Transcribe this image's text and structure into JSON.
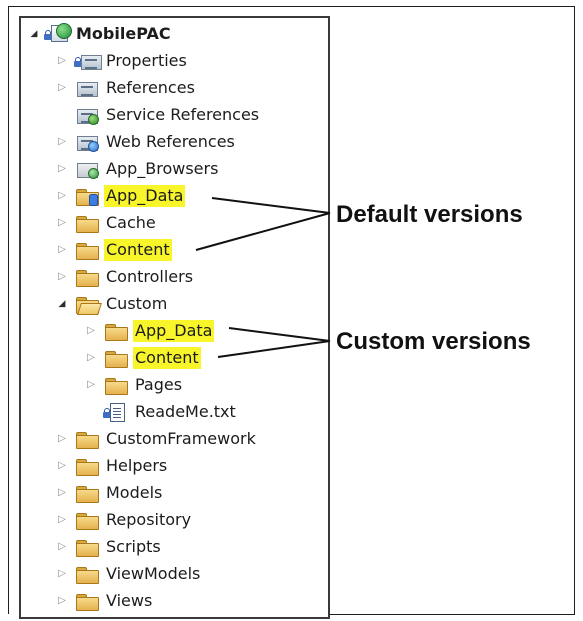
{
  "tree": {
    "root": {
      "label": "MobilePAC",
      "expanded": true,
      "icon": "csharp-project-icon"
    },
    "items": [
      {
        "label": "Properties",
        "icon": "properties-icon",
        "arrow": "collapsed",
        "highlight": false
      },
      {
        "label": "References",
        "icon": "references-icon",
        "arrow": "collapsed",
        "highlight": false
      },
      {
        "label": "Service References",
        "icon": "service-references-icon",
        "arrow": "none",
        "highlight": false
      },
      {
        "label": "Web References",
        "icon": "web-references-icon",
        "arrow": "collapsed",
        "highlight": false
      },
      {
        "label": "App_Browsers",
        "icon": "app-browsers-folder-icon",
        "arrow": "collapsed",
        "highlight": false
      },
      {
        "label": "App_Data",
        "icon": "app-data-folder-icon",
        "arrow": "collapsed",
        "highlight": true
      },
      {
        "label": "Cache",
        "icon": "folder-icon",
        "arrow": "collapsed",
        "highlight": false
      },
      {
        "label": "Content",
        "icon": "folder-icon",
        "arrow": "collapsed",
        "highlight": true
      },
      {
        "label": "Controllers",
        "icon": "folder-icon",
        "arrow": "collapsed",
        "highlight": false
      },
      {
        "label": "Custom",
        "icon": "folder-open-icon",
        "arrow": "expanded",
        "highlight": false,
        "children": [
          {
            "label": "App_Data",
            "icon": "folder-icon",
            "arrow": "collapsed",
            "highlight": true
          },
          {
            "label": "Content",
            "icon": "folder-icon",
            "arrow": "collapsed",
            "highlight": true
          },
          {
            "label": "Pages",
            "icon": "folder-icon",
            "arrow": "collapsed",
            "highlight": false
          },
          {
            "label": "ReadeMe.txt",
            "icon": "text-file-icon",
            "arrow": "none",
            "highlight": false
          }
        ]
      },
      {
        "label": "CustomFramework",
        "icon": "folder-icon",
        "arrow": "collapsed",
        "highlight": false
      },
      {
        "label": "Helpers",
        "icon": "folder-icon",
        "arrow": "collapsed",
        "highlight": false
      },
      {
        "label": "Models",
        "icon": "folder-icon",
        "arrow": "collapsed",
        "highlight": false
      },
      {
        "label": "Repository",
        "icon": "folder-icon",
        "arrow": "collapsed",
        "highlight": false
      },
      {
        "label": "Scripts",
        "icon": "folder-icon",
        "arrow": "collapsed",
        "highlight": false
      },
      {
        "label": "ViewModels",
        "icon": "folder-icon",
        "arrow": "collapsed",
        "highlight": false
      },
      {
        "label": "Views",
        "icon": "folder-icon",
        "arrow": "collapsed",
        "highlight": false
      }
    ]
  },
  "annotations": {
    "default_label": "Default versions",
    "custom_label": "Custom versions"
  },
  "colors": {
    "highlight": "#f8f52a",
    "text": "#1c1c1c",
    "folder": "#e5b24f"
  }
}
